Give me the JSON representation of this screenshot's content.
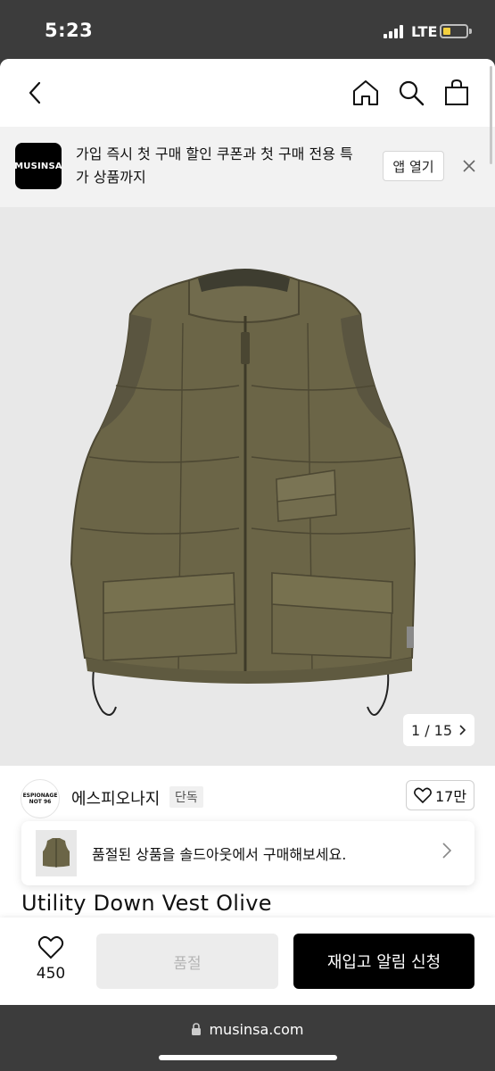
{
  "status_bar": {
    "time": "5:23",
    "network": "LTE",
    "battery_level": 0.35,
    "battery_color": "#f4d03f"
  },
  "nav": {
    "back_icon": "chevron-left-icon",
    "home_icon": "home-icon",
    "search_icon": "search-icon",
    "cart_icon": "shopping-bag-icon"
  },
  "app_banner": {
    "logo_text": "MUSINSA",
    "message": "가입 즉시 첫 구매 할인 쿠폰과 첫 구매 전용 특가 상품까지",
    "open_button": "앱 열기",
    "close_icon": "close-icon"
  },
  "product": {
    "image_counter": "1 / 15",
    "brand_logo_text": "ESPIONAGE NOT 96",
    "brand_name": "에스피오나지",
    "badge": "단독",
    "likes": "17만",
    "title": "Utility Down Vest Olive",
    "vest_color": "#6b6547"
  },
  "soldout_banner": {
    "text": "품절된 상품을 솔드아웃에서 구매해보세요."
  },
  "action_bar": {
    "wishlist_count": "450",
    "soldout_label": "품절",
    "restock_label": "재입고 알림 신청"
  },
  "browser": {
    "url": "musinsa.com"
  }
}
